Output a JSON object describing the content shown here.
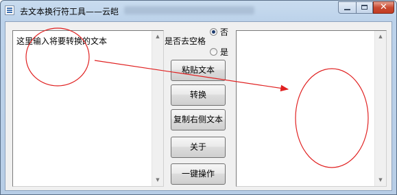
{
  "window": {
    "title": "去文本换行符工具——云皑",
    "close_glyph": "✕"
  },
  "left_panel": {
    "text": "这里输入将要转换的文本"
  },
  "options": {
    "label": "是否去空格",
    "radio_no": "否",
    "radio_yes": "是",
    "selected": "否"
  },
  "buttons": {
    "paste": "粘贴文本",
    "convert": "转换",
    "copy_right": "复制右侧文本",
    "about": "关于",
    "one_click": "一键操作"
  },
  "scroll_arrows": {
    "up": "▲",
    "down": "▼"
  },
  "annotation_color": "#e02020"
}
